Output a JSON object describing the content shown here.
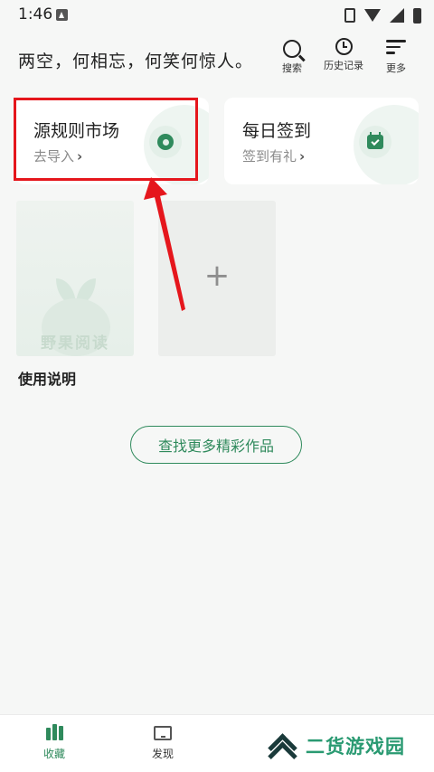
{
  "status_bar": {
    "time": "1:46"
  },
  "header": {
    "quote": "两空，何相忘，何笑何惊人。",
    "actions": [
      {
        "icon": "search-icon",
        "label": "搜索"
      },
      {
        "icon": "history-icon",
        "label": "历史记录"
      },
      {
        "icon": "menu-icon",
        "label": "更多"
      }
    ]
  },
  "cards": [
    {
      "title": "源规则市场",
      "subtitle": "去导入",
      "icon": "target-ring-icon"
    },
    {
      "title": "每日签到",
      "subtitle": "签到有礼",
      "icon": "calendar-check-icon"
    }
  ],
  "shelf": {
    "book_cover_title": "野果阅读",
    "book_caption": "使用说明",
    "add_label": "+"
  },
  "find_more_button": "查找更多精彩作品",
  "bottom_nav": [
    {
      "label": "收藏",
      "active": true
    },
    {
      "label": "发现",
      "active": false
    }
  ],
  "watermark": {
    "text": "二货游戏园"
  },
  "colors": {
    "accent": "#2f8a5c",
    "highlight": "#e5161c",
    "background": "#f6f7f6"
  }
}
